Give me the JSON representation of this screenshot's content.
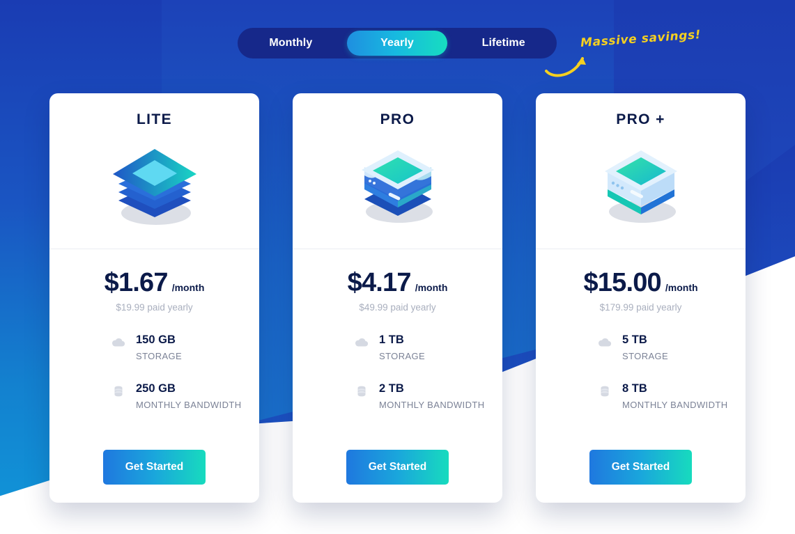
{
  "billing_toggle": {
    "options": [
      {
        "label": "Monthly",
        "active": false
      },
      {
        "label": "Yearly",
        "active": true
      },
      {
        "label": "Lifetime",
        "active": false
      }
    ]
  },
  "savings_note": {
    "text": "Massive savings!",
    "color": "#f5d020",
    "arrow_icon": "curved-arrow-icon"
  },
  "colors": {
    "background_blue": "#1b3cb2",
    "background_azure": "#1097d9",
    "toggle_track": "#16288a",
    "accent_gradient_start": "#1f78df",
    "accent_gradient_end": "#17dbbe",
    "title_navy": "#0b1a49",
    "muted_text": "#7b8296",
    "price_sub_text": "#a9afbe"
  },
  "plans": [
    {
      "title": "LITE",
      "art_icon": "stacked-layers-icon",
      "price_amount": "$1.67",
      "price_period": "/month",
      "price_sub": "$19.99 paid yearly",
      "features": [
        {
          "icon": "cloud-icon",
          "value": "150 GB",
          "label": "STORAGE"
        },
        {
          "icon": "database-icon",
          "value": "250 GB",
          "label": "MONTHLY BANDWIDTH"
        }
      ],
      "cta_label": "Get Started"
    },
    {
      "title": "PRO",
      "art_icon": "cube-stack-icon",
      "price_amount": "$4.17",
      "price_period": "/month",
      "price_sub": "$49.99 paid yearly",
      "features": [
        {
          "icon": "cloud-icon",
          "value": "1 TB",
          "label": "STORAGE"
        },
        {
          "icon": "database-icon",
          "value": "2 TB",
          "label": "MONTHLY BANDWIDTH"
        }
      ],
      "cta_label": "Get Started"
    },
    {
      "title": "PRO +",
      "art_icon": "server-cube-icon",
      "price_amount": "$15.00",
      "price_period": "/month",
      "price_sub": "$179.99 paid yearly",
      "features": [
        {
          "icon": "cloud-icon",
          "value": "5 TB",
          "label": "STORAGE"
        },
        {
          "icon": "database-icon",
          "value": "8 TB",
          "label": "MONTHLY BANDWIDTH"
        }
      ],
      "cta_label": "Get Started"
    }
  ]
}
